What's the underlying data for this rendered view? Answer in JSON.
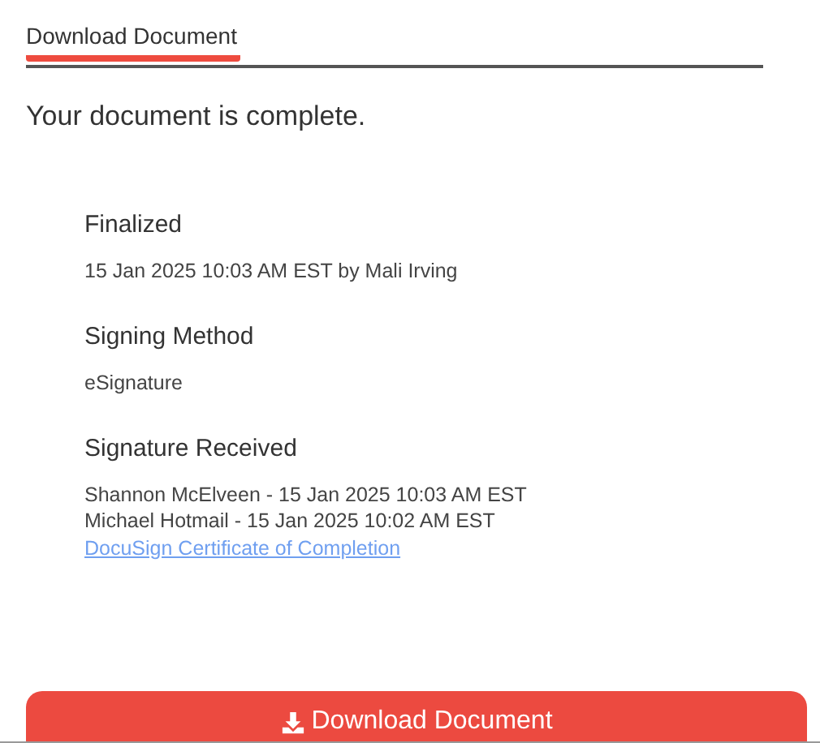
{
  "tabs": [
    {
      "label": "Download Document",
      "selected": true
    }
  ],
  "heading": "Your document is complete.",
  "sections": [
    {
      "title": "Finalized",
      "lines": [
        "15 Jan 2025 10:03 AM EST by Mali Irving"
      ]
    },
    {
      "title": "Signing Method",
      "lines": [
        "eSignature"
      ]
    },
    {
      "title": "Signature Received",
      "lines": [
        "Shannon McElveen - 15 Jan 2025 10:03 AM EST",
        "Michael Hotmail - 15 Jan 2025 10:02 AM EST"
      ],
      "link": "DocuSign Certificate of Completion"
    }
  ],
  "button": {
    "label": "Download Document"
  }
}
